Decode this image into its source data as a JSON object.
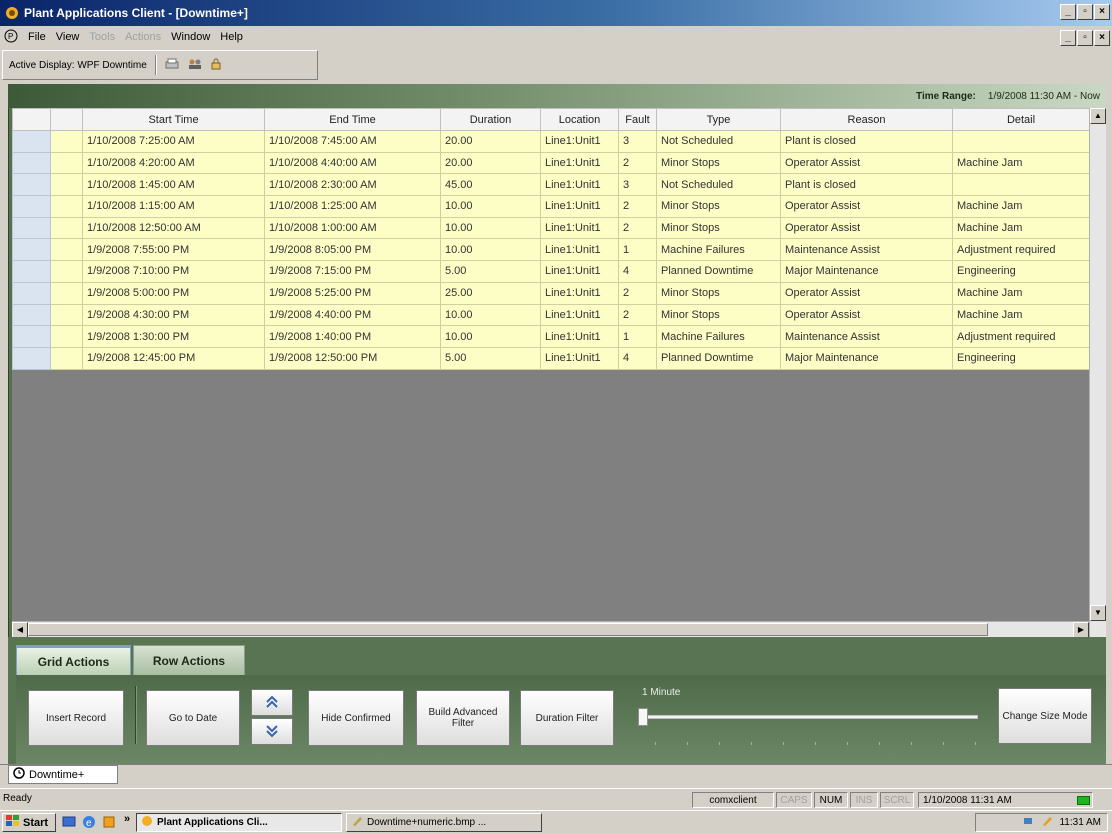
{
  "window": {
    "title": "Plant Applications Client - [Downtime+]"
  },
  "menu": {
    "items": [
      {
        "label": "File",
        "enabled": true
      },
      {
        "label": "View",
        "enabled": true
      },
      {
        "label": "Tools",
        "enabled": false
      },
      {
        "label": "Actions",
        "enabled": false
      },
      {
        "label": "Window",
        "enabled": true
      },
      {
        "label": "Help",
        "enabled": true
      }
    ]
  },
  "toolbar": {
    "active_display": "Active Display: WPF Downtime"
  },
  "time_range": {
    "label": "Time Range:",
    "value": "1/9/2008 11:30 AM - Now"
  },
  "grid": {
    "columns": [
      "Start Time",
      "End Time",
      "Duration",
      "Location",
      "Fault",
      "Type",
      "Reason",
      "Detail"
    ],
    "rows": [
      [
        "1/10/2008 7:25:00 AM",
        "1/10/2008 7:45:00 AM",
        "20.00",
        "Line1:Unit1",
        "3",
        "Not Scheduled",
        "Plant is closed",
        ""
      ],
      [
        "1/10/2008 4:20:00 AM",
        "1/10/2008 4:40:00 AM",
        "20.00",
        "Line1:Unit1",
        "2",
        "Minor Stops",
        "Operator Assist",
        "Machine Jam"
      ],
      [
        "1/10/2008 1:45:00 AM",
        "1/10/2008 2:30:00 AM",
        "45.00",
        "Line1:Unit1",
        "3",
        "Not Scheduled",
        "Plant is closed",
        ""
      ],
      [
        "1/10/2008 1:15:00 AM",
        "1/10/2008 1:25:00 AM",
        "10.00",
        "Line1:Unit1",
        "2",
        "Minor Stops",
        "Operator Assist",
        "Machine Jam"
      ],
      [
        "1/10/2008 12:50:00 AM",
        "1/10/2008 1:00:00 AM",
        "10.00",
        "Line1:Unit1",
        "2",
        "Minor Stops",
        "Operator Assist",
        "Machine Jam"
      ],
      [
        "1/9/2008 7:55:00 PM",
        "1/9/2008 8:05:00 PM",
        "10.00",
        "Line1:Unit1",
        "1",
        "Machine Failures",
        "Maintenance Assist",
        "Adjustment required"
      ],
      [
        "1/9/2008 7:10:00 PM",
        "1/9/2008 7:15:00 PM",
        "5.00",
        "Line1:Unit1",
        "4",
        "Planned Downtime",
        "Major Maintenance",
        "Engineering"
      ],
      [
        "1/9/2008 5:00:00 PM",
        "1/9/2008 5:25:00 PM",
        "25.00",
        "Line1:Unit1",
        "2",
        "Minor Stops",
        "Operator Assist",
        "Machine Jam"
      ],
      [
        "1/9/2008 4:30:00 PM",
        "1/9/2008 4:40:00 PM",
        "10.00",
        "Line1:Unit1",
        "2",
        "Minor Stops",
        "Operator Assist",
        "Machine Jam"
      ],
      [
        "1/9/2008 1:30:00 PM",
        "1/9/2008 1:40:00 PM",
        "10.00",
        "Line1:Unit1",
        "1",
        "Machine Failures",
        "Maintenance Assist",
        "Adjustment required"
      ],
      [
        "1/9/2008 12:45:00 PM",
        "1/9/2008 12:50:00 PM",
        "5.00",
        "Line1:Unit1",
        "4",
        "Planned Downtime",
        "Major Maintenance",
        "Engineering"
      ]
    ]
  },
  "tabs": {
    "grid_actions": "Grid Actions",
    "row_actions": "Row Actions"
  },
  "actions": {
    "insert_record": "Insert Record",
    "go_to_date": "Go to Date",
    "hide_confirmed": "Hide Confirmed",
    "build_advanced_filter": "Build Advanced Filter",
    "duration_filter": "Duration Filter",
    "slider_label": "1 Minute",
    "change_size_mode": "Change Size Mode",
    "scroll_up_icon": "double-chevron-up-icon",
    "scroll_down_icon": "double-chevron-down-icon"
  },
  "document_tab": {
    "label": "Downtime+"
  },
  "status": {
    "text": "Ready",
    "user": "comxclient",
    "caps": "CAPS",
    "num": "NUM",
    "ins": "INS",
    "scrl": "SCRL",
    "datetime": "1/10/2008 11:31 AM"
  },
  "taskbar": {
    "start": "start",
    "tasks": [
      "Plant Applications Cli...",
      "Downtime+numeric.bmp ..."
    ],
    "clock": "11:31 AM"
  },
  "colors": {
    "row_bg": "#fdfdc6",
    "panel_green": "#57714f",
    "title_blue": "#0a246a"
  }
}
